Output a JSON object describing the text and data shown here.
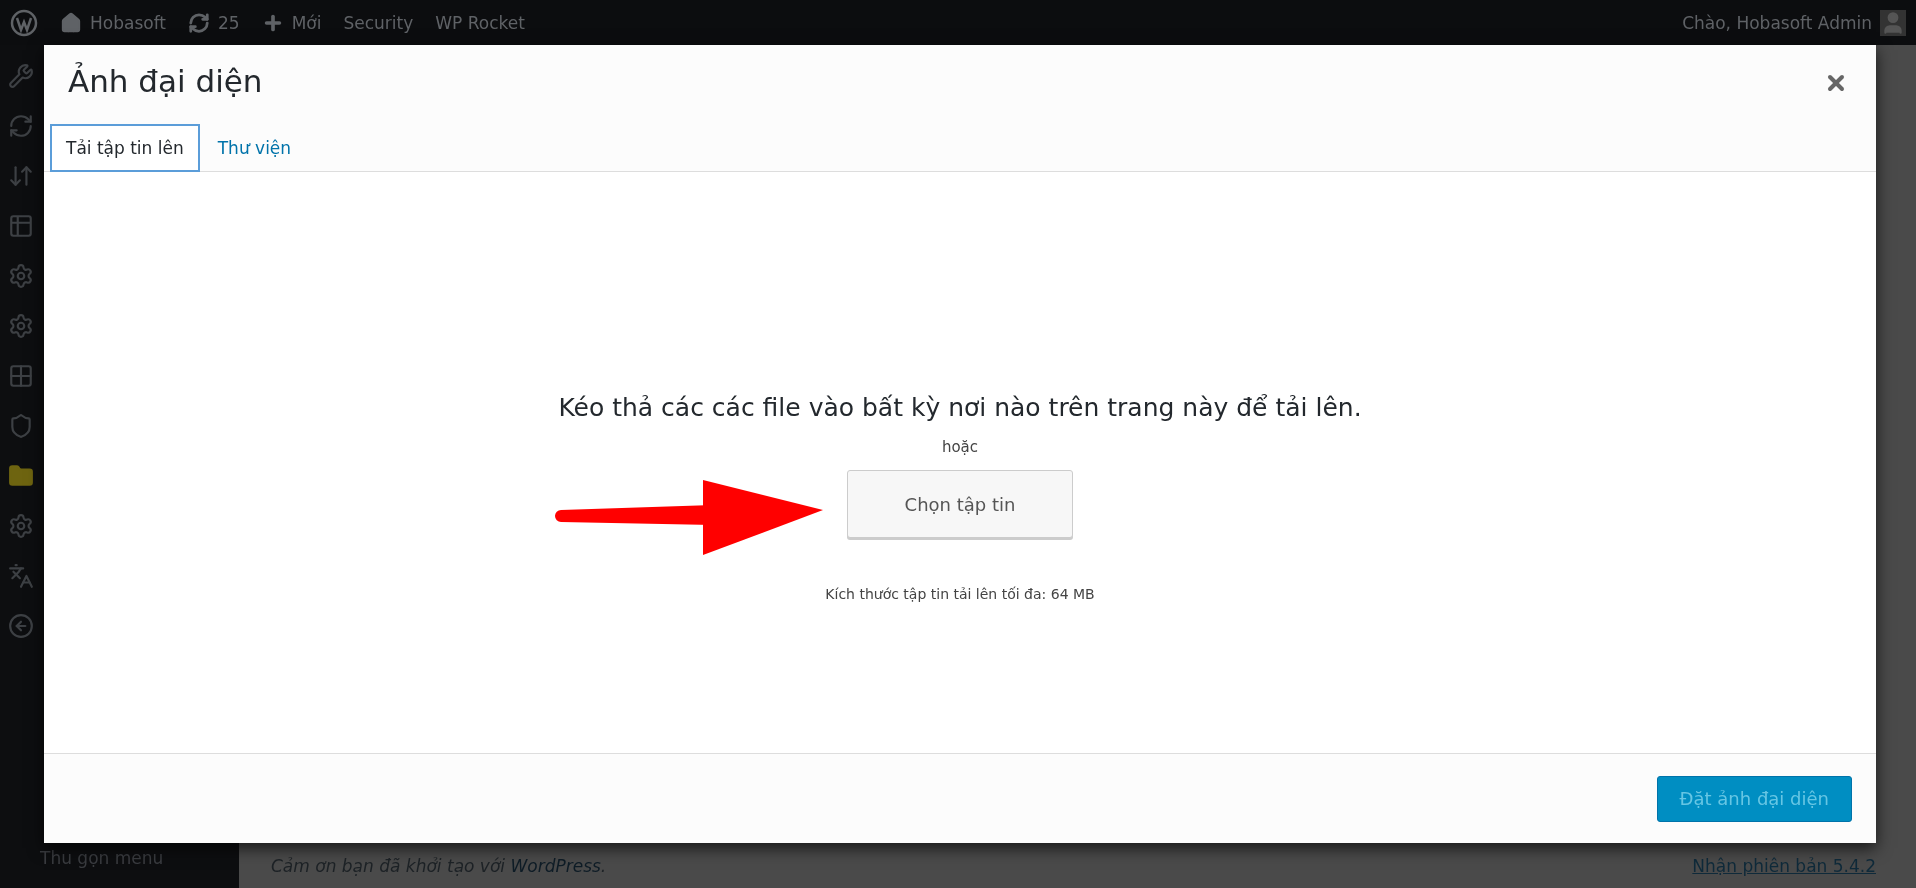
{
  "admin_bar": {
    "site": "Hobasoft",
    "updates": "25",
    "new": "Mới",
    "items": [
      "Security",
      "WP Rocket"
    ],
    "greeting": "Chào, Hobasoft Admin"
  },
  "sidebar": {
    "collapse": "Thu gọn menu"
  },
  "modal": {
    "title": "Ảnh đại diện",
    "tabs": [
      {
        "label": "Tải tập tin lên",
        "selected": true
      },
      {
        "label": "Thư viện",
        "selected": false
      }
    ],
    "drop_text": "Kéo thả các các file vào bất kỳ nơi nào trên trang này để tải lên.",
    "or": "hoặc",
    "select_button": "Chọn tập tin",
    "max_size": "Kích thước tập tin tải lên tối đa: 64 MB",
    "primary_button": {
      "label": "Đặt ảnh đại diện",
      "disabled": true
    }
  },
  "footer": {
    "thanks": "Cảm ơn bạn đã khởi tạo với ",
    "link": "WordPress",
    "end": ".",
    "version": "Nhận phiên bản 5.4.2"
  }
}
